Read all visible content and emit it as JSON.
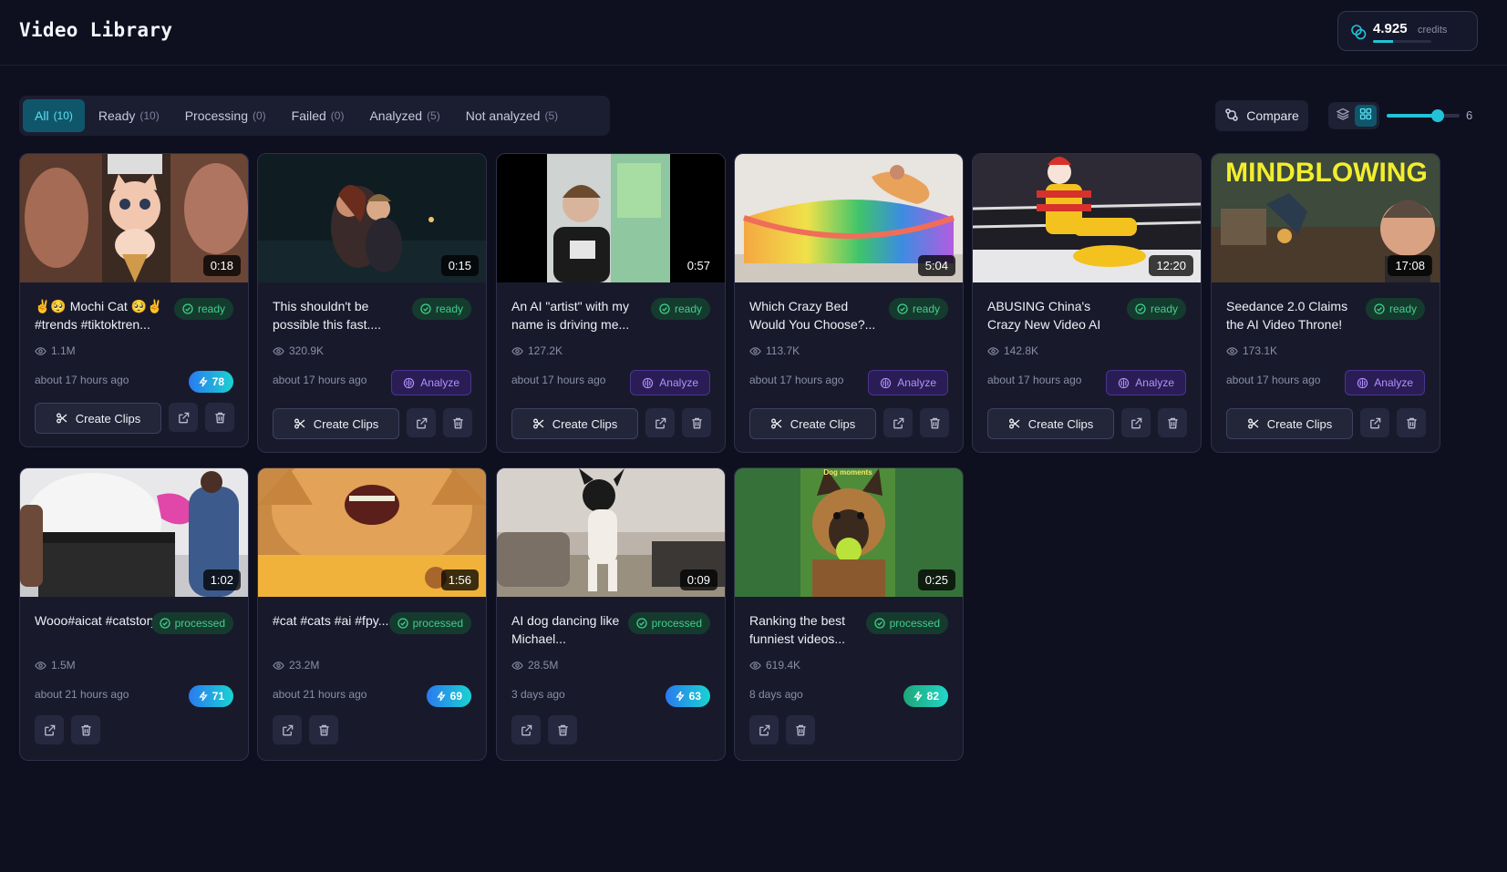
{
  "app": {
    "title": "Video Library"
  },
  "credits": {
    "value": "4.925",
    "label": "credits",
    "level": 0.35,
    "accent": "#22c3d6"
  },
  "tabs": [
    {
      "label": "All",
      "count": "(10)",
      "active": true
    },
    {
      "label": "Ready",
      "count": "(10)"
    },
    {
      "label": "Processing",
      "count": "(0)"
    },
    {
      "label": "Failed",
      "count": "(0)"
    },
    {
      "label": "Analyzed",
      "count": "(5)"
    },
    {
      "label": "Not analyzed",
      "count": "(5)"
    }
  ],
  "toolbar": {
    "compare_label": "Compare",
    "columns_value": "6",
    "columns_level": 0.7
  },
  "labels": {
    "create_clips": "Create Clips",
    "analyze": "Analyze"
  },
  "videos": [
    {
      "title": "✌️🥺 Mochi Cat 🥺✌️ #trends #tiktoktren...",
      "duration": "0:18",
      "status": "ready",
      "views": "1.1M",
      "age": "about 17 hours ago",
      "score": "78",
      "thumb_icon": "kitten-icecream-thumbnail"
    },
    {
      "title": "This shouldn't be possible this fast....",
      "duration": "0:15",
      "status": "ready",
      "views": "320.9K",
      "age": "about 17 hours ago",
      "analyze": true,
      "thumb_icon": "titanic-couple-thumbnail"
    },
    {
      "title": "An AI \"artist\" with my name is driving me...",
      "duration": "0:57",
      "status": "ready",
      "views": "127.2K",
      "age": "about 17 hours ago",
      "analyze": true,
      "thumb_icon": "talking-man-thumbnail"
    },
    {
      "title": "Which Crazy Bed Would You Choose?...",
      "duration": "5:04",
      "status": "ready",
      "views": "113.7K",
      "age": "about 17 hours ago",
      "analyze": true,
      "thumb_icon": "rainbow-bed-thumbnail"
    },
    {
      "title": "ABUSING China's Crazy New Video AI",
      "duration": "12:20",
      "status": "ready",
      "views": "142.8K",
      "age": "about 17 hours ago",
      "analyze": true,
      "thumb_icon": "clown-wrestling-thumbnail"
    },
    {
      "title": "Seedance 2.0 Claims the AI Video Throne!",
      "duration": "17:08",
      "status": "ready",
      "views": "173.1K",
      "age": "about 17 hours ago",
      "analyze": true,
      "thumb_text": "MINDBLOWING",
      "thumb_icon": "action-scene-thumbnail"
    },
    {
      "title": "Wooo#aicat #catstory...",
      "duration": "1:02",
      "status": "processed",
      "views": "1.5M",
      "age": "about 21 hours ago",
      "score": "71",
      "thumb_icon": "belly-man-thumbnail"
    },
    {
      "title": "#cat #cats #ai #fpy...",
      "duration": "1:56",
      "status": "processed",
      "views": "23.2M",
      "age": "about 21 hours ago",
      "score": "69",
      "thumb_icon": "screaming-cat-thumbnail"
    },
    {
      "title": "AI dog dancing like Michael...",
      "duration": "0:09",
      "status": "processed",
      "views": "28.5M",
      "age": "3 days ago",
      "score": "63",
      "thumb_icon": "dancing-dog-thumbnail"
    },
    {
      "title": "Ranking the best funniest videos...",
      "duration": "0:25",
      "status": "processed",
      "views": "619.4K",
      "age": "8 days ago",
      "score": "82",
      "thumb_text": "Dog moments",
      "thumb_icon": "german-shepherd-thumbnail"
    }
  ]
}
